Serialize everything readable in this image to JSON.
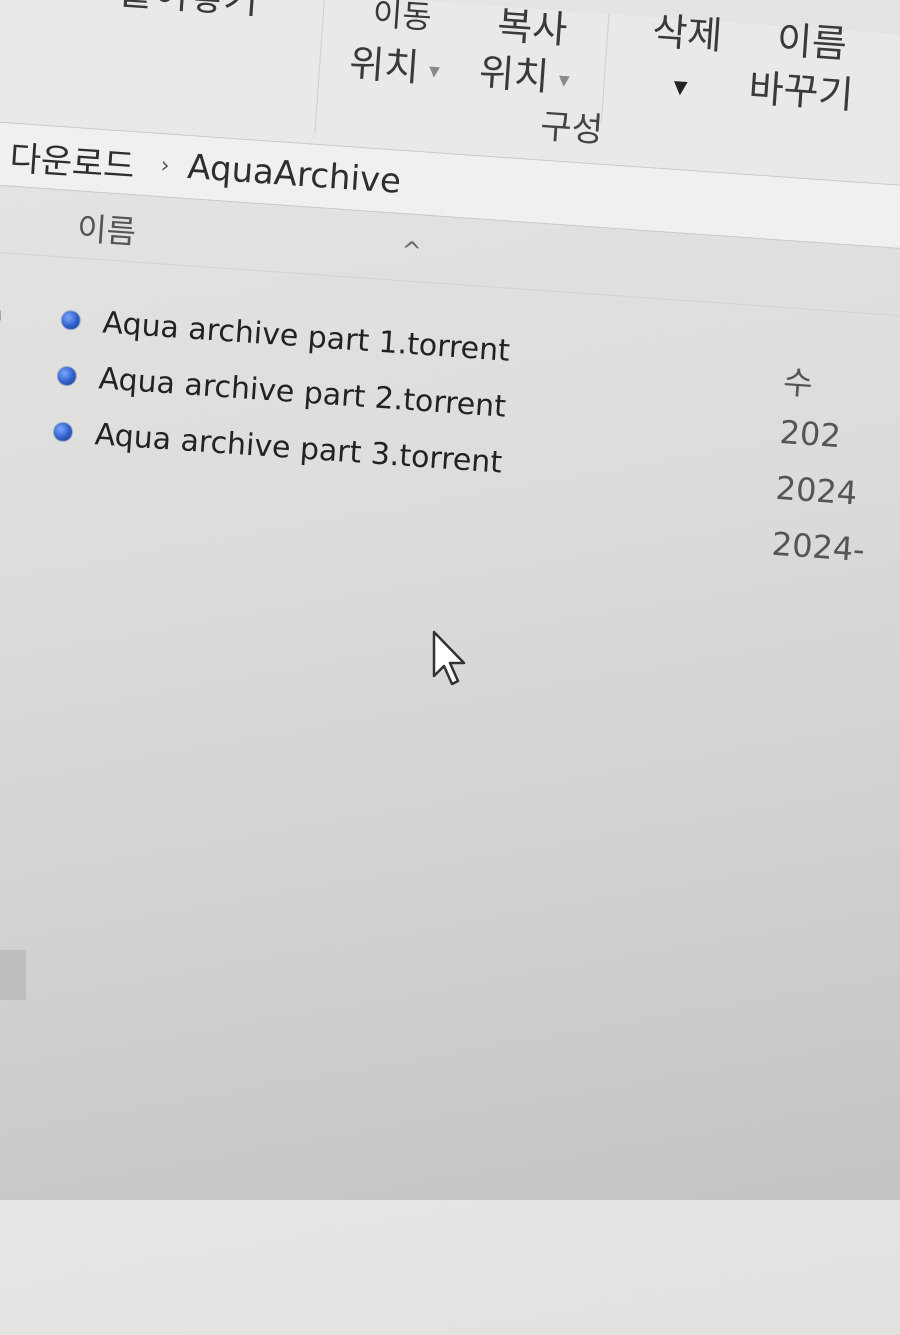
{
  "ribbon": {
    "paste": "붙여넣기",
    "move_to_top": "이동",
    "move_to_bottom": "위치",
    "copy_to_top": "복사",
    "copy_to_bottom": "위치",
    "delete": "삭제",
    "rename_top": "이름",
    "rename_bottom": "바꾸기",
    "group_organize": "구성"
  },
  "address": {
    "crumbs": [
      "다운로드",
      "AquaArchive"
    ]
  },
  "columns": {
    "name": "이름",
    "date": "수"
  },
  "files": [
    {
      "name": "Aqua archive part 1.torrent",
      "date": "202"
    },
    {
      "name": "Aqua archive part 2.torrent",
      "date": "2024"
    },
    {
      "name": "Aqua archive part 3.torrent",
      "date": "2024-"
    }
  ],
  "icons": {
    "file": "torrent-file-icon",
    "pin": "pin-icon",
    "sort": "sort-ascending-icon",
    "pointer": "mouse-pointer-icon"
  }
}
